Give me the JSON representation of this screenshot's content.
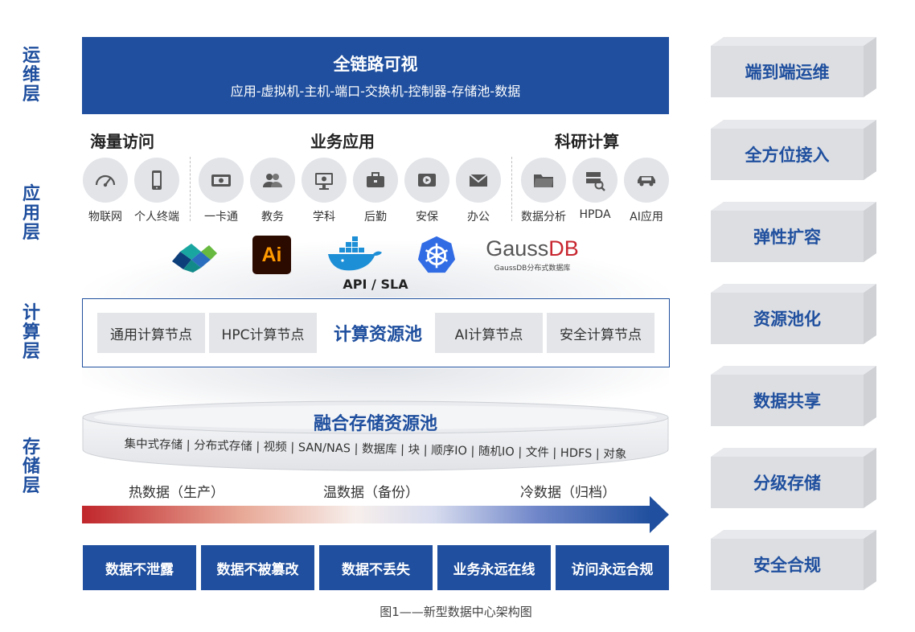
{
  "layers": [
    "运维层",
    "应用层",
    "计算层",
    "存储层"
  ],
  "banner": {
    "title": "全链路可视",
    "subtitle": "应用-虚拟机-主机-端口-交换机-控制器-存储池-数据"
  },
  "app_groups": [
    {
      "title": "海量访问",
      "items": [
        {
          "label": "物联网",
          "icon": "gauge-icon"
        },
        {
          "label": "个人终端",
          "icon": "mobile-phone-icon"
        }
      ]
    },
    {
      "title": "业务应用",
      "items": [
        {
          "label": "一卡通",
          "icon": "card-icon"
        },
        {
          "label": "教务",
          "icon": "users-icon"
        },
        {
          "label": "学科",
          "icon": "monitor-icon"
        },
        {
          "label": "后勤",
          "icon": "toolbox-icon"
        },
        {
          "label": "安保",
          "icon": "video-icon"
        },
        {
          "label": "办公",
          "icon": "mail-icon"
        }
      ]
    },
    {
      "title": "科研计算",
      "items": [
        {
          "label": "数据分析",
          "icon": "folder-icon"
        },
        {
          "label": "HPDA",
          "icon": "server-search-icon"
        },
        {
          "label": "AI应用",
          "icon": "car-icon"
        }
      ]
    }
  ],
  "logos": {
    "vmware_icon": "vmware-logo",
    "ai_text": "Ai",
    "docker_icon": "docker-logo",
    "kubernetes_icon": "kubernetes-logo",
    "gaussdb_text_a": "Gauss",
    "gaussdb_text_b": "DB",
    "gaussdb_sub": "GaussDB分布式数据库"
  },
  "api_label": "API / SLA",
  "compute": {
    "title": "计算资源池",
    "nodes": [
      "通用计算节点",
      "HPC计算节点",
      "AI计算节点",
      "安全计算节点"
    ]
  },
  "storage": {
    "title": "融合存储资源池",
    "types": "集中式存储 | 分布式存储 | 视频 | SAN/NAS | 数据库 | 块 | 顺序IO | 随机IO | 文件 | HDFS | 对象"
  },
  "temperature": [
    "热数据（生产）",
    "温数据（备份）",
    "冷数据（归档）"
  ],
  "security": [
    "数据不泄露",
    "数据不被篡改",
    "数据不丢失",
    "业务永远在线",
    "访问永远合规"
  ],
  "caption": "图1——新型数据中心架构图",
  "right_features": [
    "端到端运维",
    "全方位接入",
    "弹性扩容",
    "资源池化",
    "数据共享",
    "分级存储",
    "安全合规"
  ],
  "colors": {
    "primary": "#1f4f9e",
    "hot": "#c0262b",
    "block_gray": "#dcdee2"
  }
}
